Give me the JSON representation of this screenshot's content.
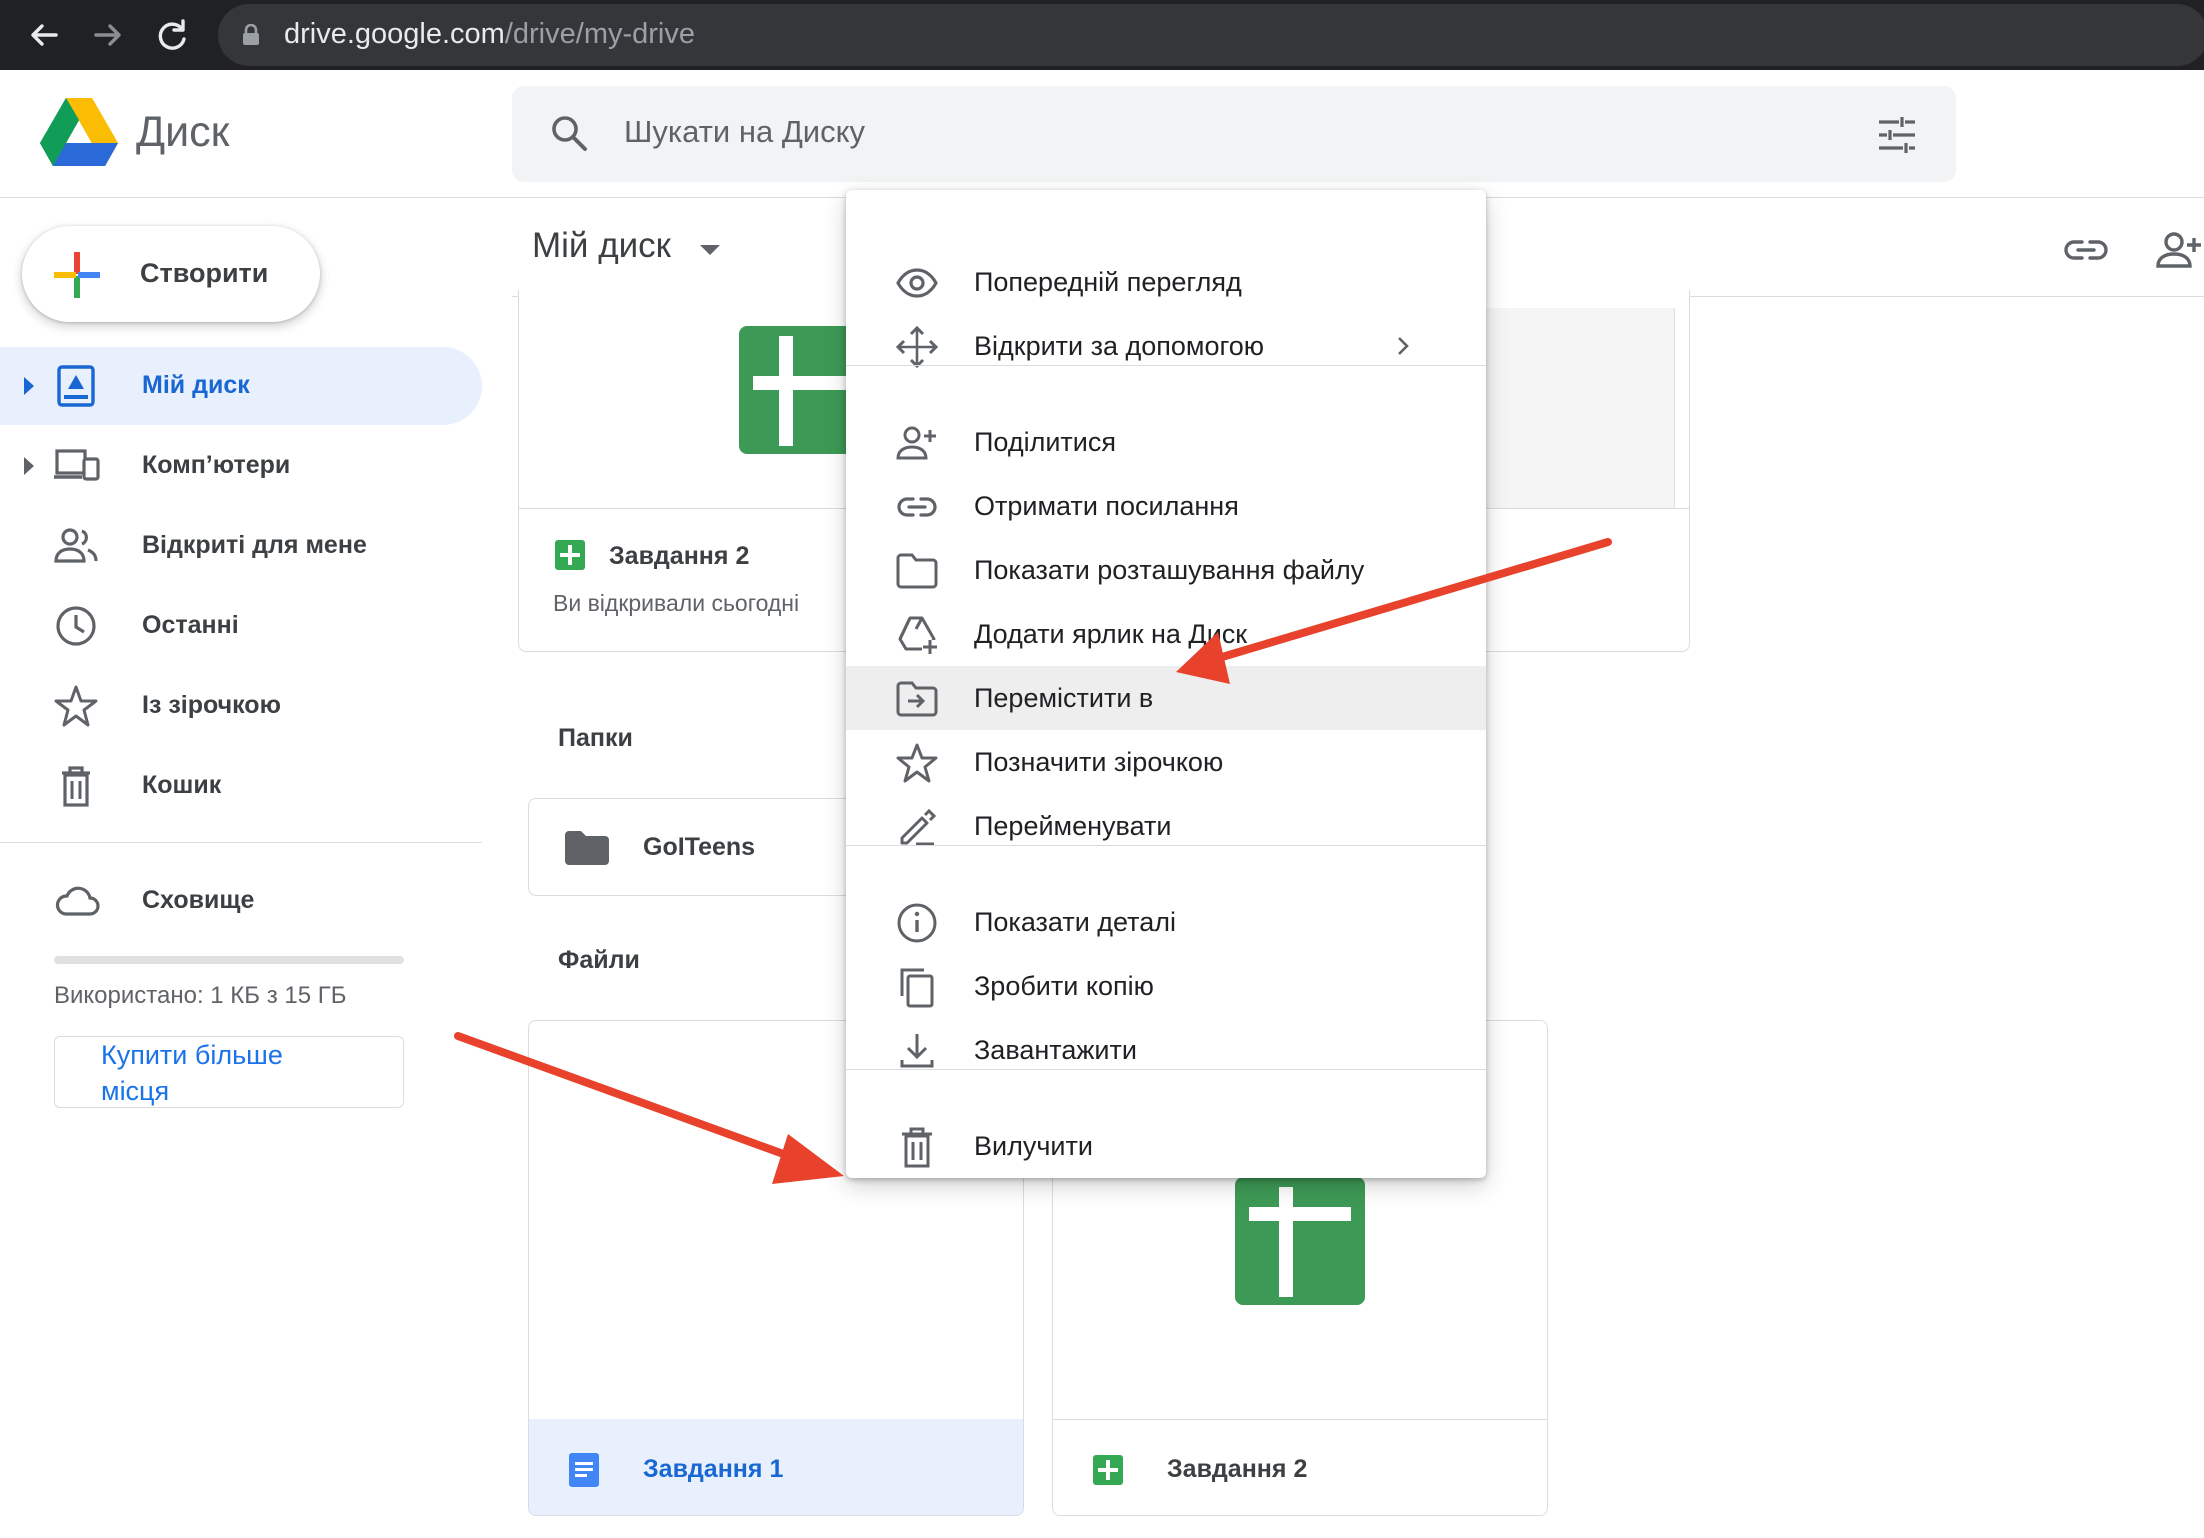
{
  "browser": {
    "url_host": "drive.google.com",
    "url_path": "/drive/my-drive"
  },
  "header": {
    "app_name": "Диск",
    "search_placeholder": "Шукати на Диску"
  },
  "sidebar": {
    "create_label": "Створити",
    "items": [
      {
        "label": "Мій диск",
        "icon": "my-drive-icon"
      },
      {
        "label": "Комп’ютери",
        "icon": "computers-icon"
      },
      {
        "label": "Відкриті для мене",
        "icon": "shared-icon"
      },
      {
        "label": "Останні",
        "icon": "clock-icon"
      },
      {
        "label": "Із зірочкою",
        "icon": "star-icon"
      },
      {
        "label": "Кошик",
        "icon": "trash-icon"
      }
    ],
    "storage_label": "Сховище",
    "storage_used": "Використано: 1 КБ з 15 ГБ",
    "buy_more": "Купити більше місця"
  },
  "main": {
    "title": "Мій диск",
    "top_card": {
      "name": "Завдання 2",
      "subtitle": "Ви відкривали сьогодні"
    },
    "folders_label": "Папки",
    "folders": [
      {
        "name": "GoITeens"
      }
    ],
    "files_label": "Файли",
    "files": [
      {
        "name": "Завдання 1",
        "type": "doc"
      },
      {
        "name": "Завдання 2",
        "type": "sheet"
      }
    ]
  },
  "context_menu": {
    "items": [
      {
        "label": "Попередній перегляд",
        "icon": "eye-icon"
      },
      {
        "label": "Відкрити за допомогою",
        "icon": "move-arrows-icon"
      },
      {
        "label": "Поділитися",
        "icon": "add-person-icon"
      },
      {
        "label": "Отримати посилання",
        "icon": "link-icon"
      },
      {
        "label": "Показати розташування файлу",
        "icon": "folder-icon"
      },
      {
        "label": "Додати ярлик на Диск",
        "icon": "drive-shortcut-icon"
      },
      {
        "label": "Перемістити в",
        "icon": "move-to-folder-icon"
      },
      {
        "label": "Позначити зірочкою",
        "icon": "star-icon"
      },
      {
        "label": "Перейменувати",
        "icon": "pencil-icon"
      },
      {
        "label": "Показати деталі",
        "icon": "info-icon"
      },
      {
        "label": "Зробити копію",
        "icon": "copy-icon"
      },
      {
        "label": "Завантажити",
        "icon": "download-icon"
      },
      {
        "label": "Вилучити",
        "icon": "trash-icon"
      }
    ]
  },
  "colors": {
    "accent_blue": "#1a73e8",
    "sheets_green": "#34a853",
    "annotation_red": "#e8412c"
  }
}
